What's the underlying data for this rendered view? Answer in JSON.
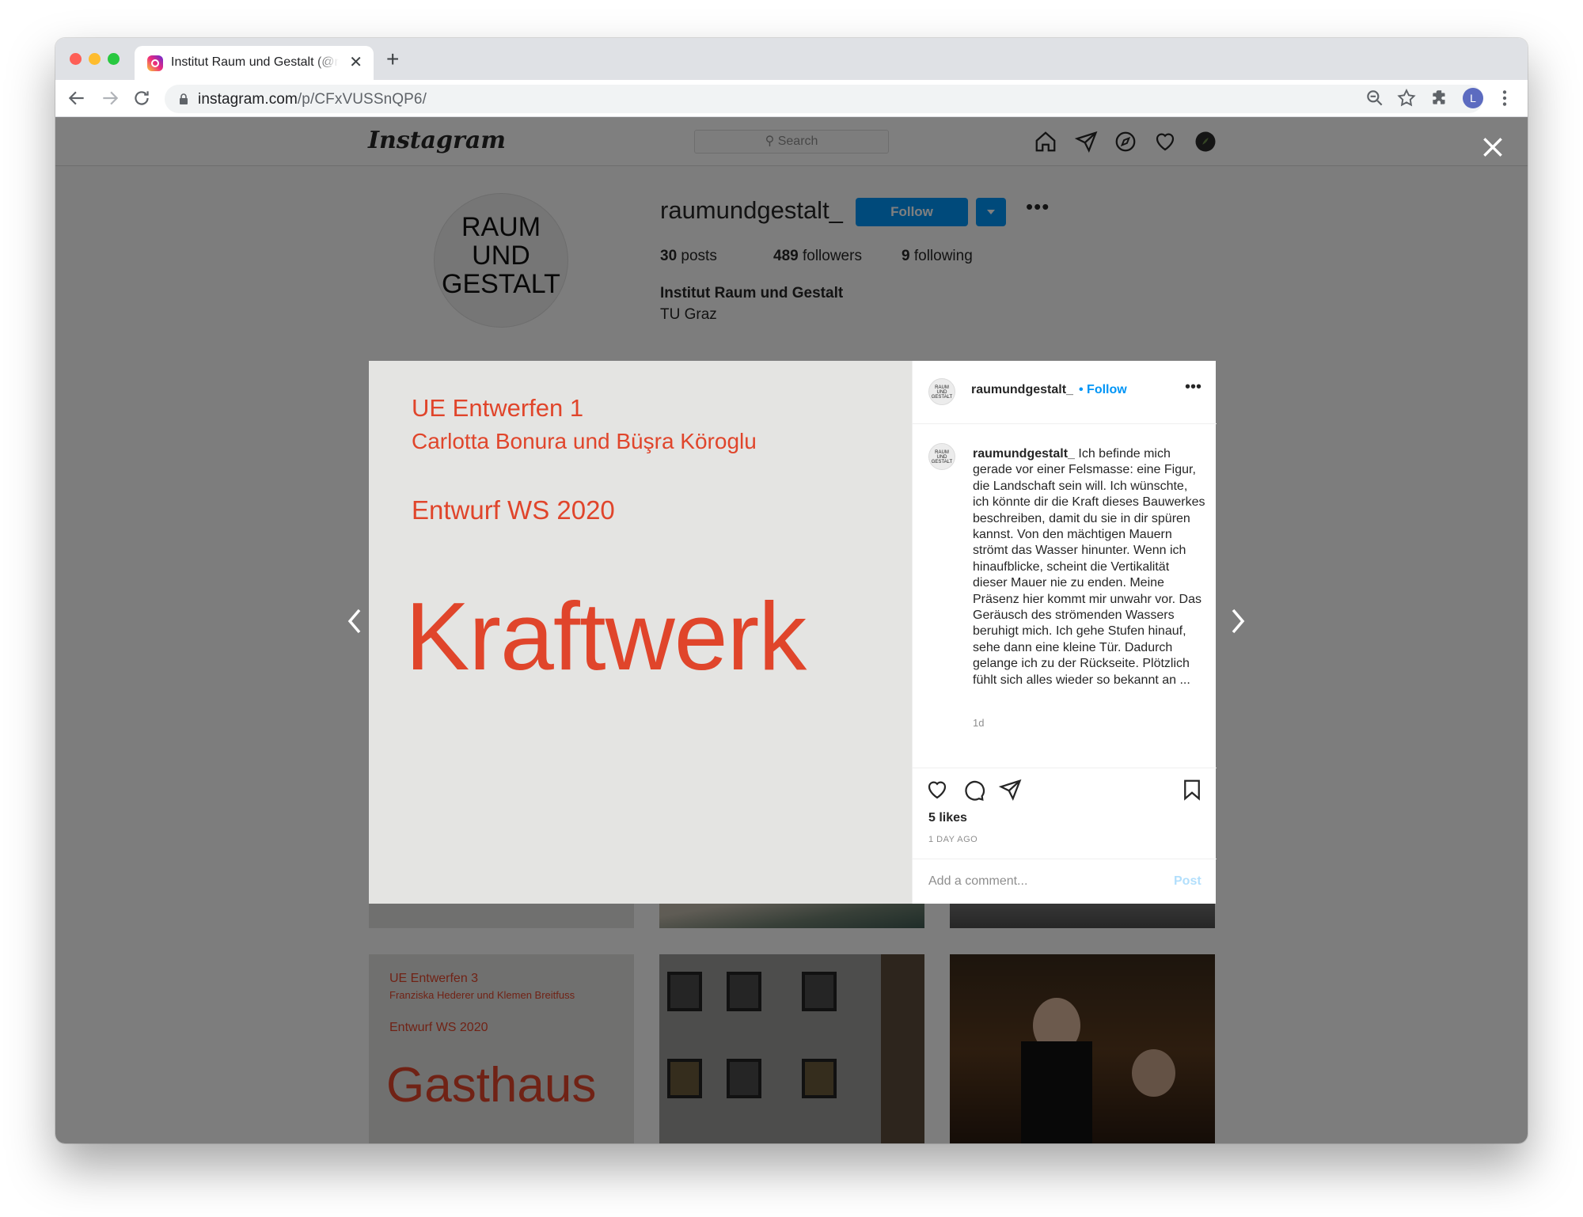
{
  "browser": {
    "tab_title": "Institut Raum und Gestalt (@raumundgestalt_)",
    "tab_close": "✕",
    "new_tab": "+",
    "url_host": "instagram.com",
    "url_path": "/p/CFxVUSSnQP6/",
    "profile_initial": "L"
  },
  "instagram": {
    "logo": "Instagram",
    "search_placeholder": "Search",
    "nav_icons": [
      "home-icon",
      "direct-icon",
      "explore-icon",
      "activity-icon",
      "profile-icon"
    ]
  },
  "profile": {
    "pic_lines": [
      "RAUM",
      "UND",
      "GESTALT"
    ],
    "username": "raumundgestalt_",
    "follow_label": "Follow",
    "posts_count": "30",
    "posts_label": "posts",
    "followers_count": "489",
    "followers_label": "followers",
    "following_count": "9",
    "following_label": "following",
    "bio_name": "Institut Raum und Gestalt",
    "bio_sub": "TU Graz"
  },
  "grid": {
    "tile4_lines": [
      "UE Entwerfen 3",
      "Franziska Hederer und Klemen Breitfuss",
      "Entwurf WS 2020",
      "Gasthaus"
    ]
  },
  "post": {
    "image_lines": [
      "UE Entwerfen 1",
      "Carlotta Bonura und Büşra Köroglu",
      "Entwurf WS 2020",
      "Kraftwerk"
    ],
    "header_user": "raumundgestalt_",
    "header_follow": "• Follow",
    "caption_user": "raumundgestalt_",
    "caption_text": "Ich befinde mich gerade vor einer Felsmasse: eine Figur, die Landschaft sein will. Ich wünschte, ich könnte dir die Kraft dieses Bauwerkes beschreiben, damit du sie in dir spüren kannst. Von den mächtigen Mauern strömt das Wasser hinunter. Wenn ich hinaufblicke, scheint die Vertikalität dieser Mauer nie zu enden. Meine Präsenz hier kommt mir unwahr vor. Das Geräusch des strömenden Wassers beruhigt mich. Ich gehe Stufen hinauf, sehe dann eine kleine Tür. Dadurch gelange ich zu der Rückseite. Plötzlich fühlt sich alles wieder so bekannt an ...",
    "caption_time": "1d",
    "likes": "5 likes",
    "date_ago": "1 DAY AGO",
    "comment_placeholder": "Add a comment...",
    "post_label": "Post"
  },
  "colors": {
    "accent_blue": "#0095f6",
    "post_red": "#e0452b"
  }
}
